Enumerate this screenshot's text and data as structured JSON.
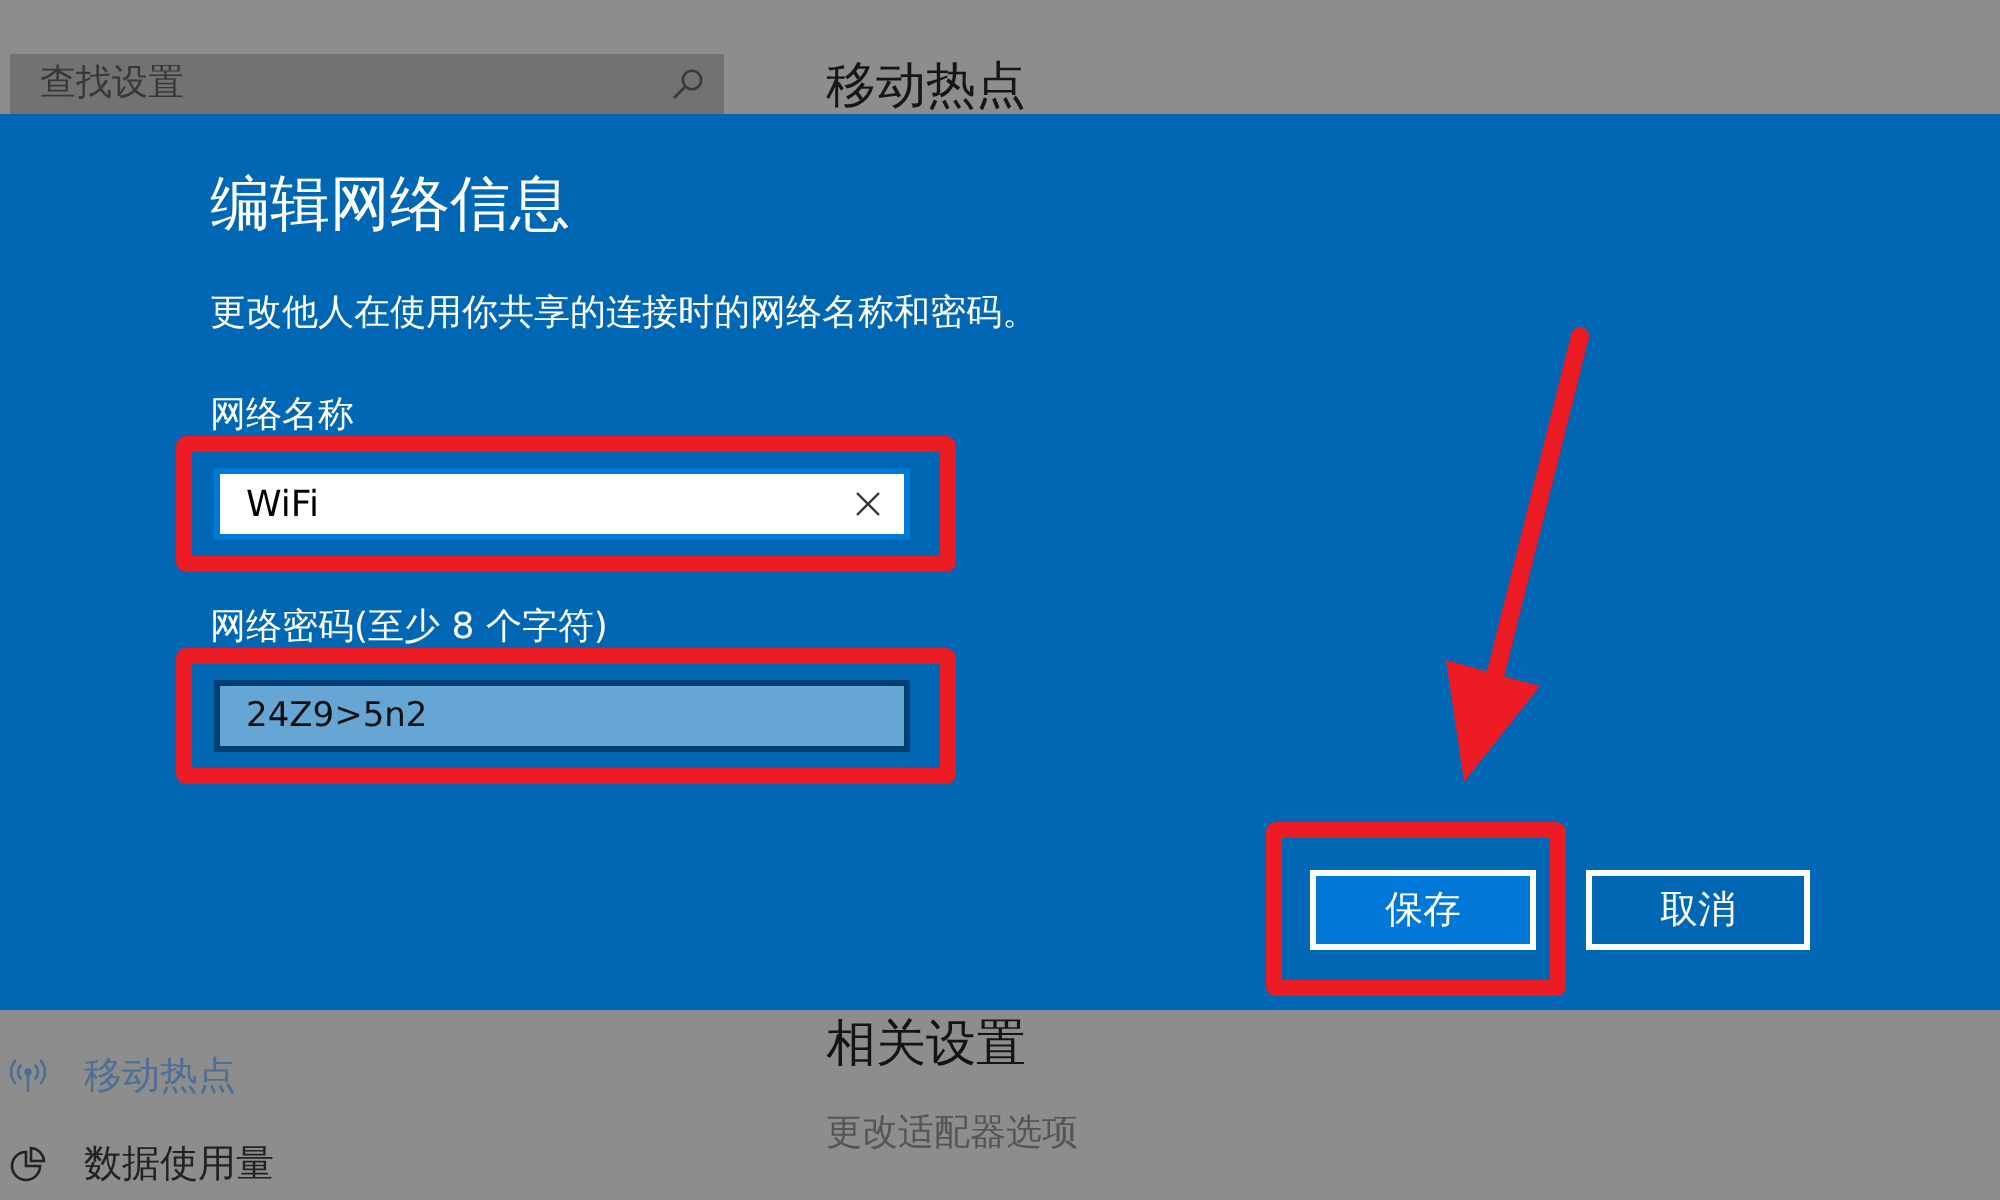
{
  "settings_page": {
    "search": {
      "placeholder": "查找设置"
    },
    "heading": "移动热点",
    "sidebar": {
      "items": [
        {
          "label": "移动热点",
          "selected": true
        },
        {
          "label": "数据使用量",
          "selected": false
        }
      ]
    },
    "related": {
      "heading": "相关设置",
      "links": [
        "更改适配器选项"
      ]
    }
  },
  "dialog": {
    "title": "编辑网络信息",
    "description": "更改他人在使用你共享的连接时的网络名称和密码。",
    "fields": [
      {
        "label": "网络名称",
        "value": "WiFi",
        "focused": true,
        "highlighted": true
      },
      {
        "label": "网络密码(至少 8 个字符)",
        "value": "24Z9>5n2",
        "focused": false,
        "highlighted": true
      }
    ],
    "buttons": [
      {
        "label": "保存",
        "kind": "primary",
        "highlighted": true,
        "arrow": true
      },
      {
        "label": "取消",
        "kind": "secondary",
        "highlighted": false,
        "arrow": false
      }
    ]
  }
}
